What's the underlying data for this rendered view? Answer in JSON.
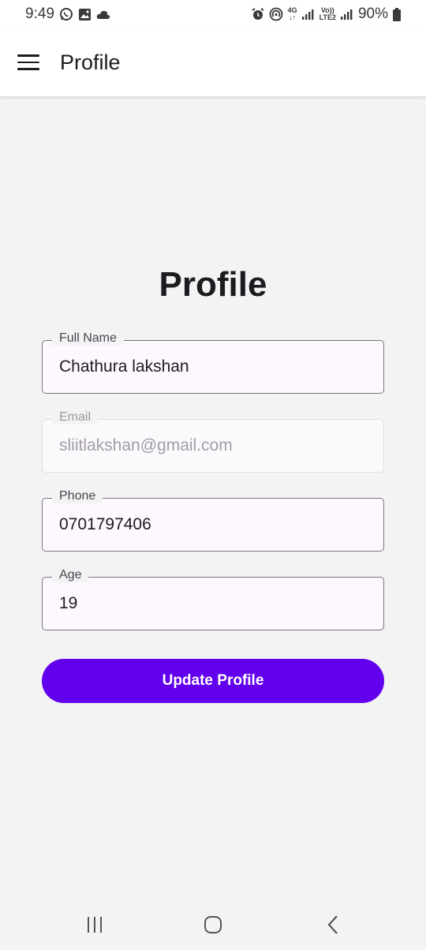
{
  "status_bar": {
    "time": "9:49",
    "network_top": "4G",
    "volte_top": "Vo))",
    "volte_bottom": "LTE2",
    "battery": "90%",
    "left_icons": [
      "whatsapp-icon",
      "gallery-icon",
      "cloud-icon"
    ],
    "right_icons": [
      "alarm-icon",
      "hotspot-icon",
      "signal-icon",
      "battery-icon"
    ]
  },
  "app_bar": {
    "title": "Profile",
    "menu_icon": "hamburger-menu-icon"
  },
  "main": {
    "heading": "Profile",
    "fields": {
      "full_name": {
        "label": "Full Name",
        "value": "Chathura lakshan"
      },
      "email": {
        "label": "Email",
        "value": "sliitlakshan@gmail.com",
        "disabled": true
      },
      "phone": {
        "label": "Phone",
        "value": "0701797406"
      },
      "age": {
        "label": "Age",
        "value": "19"
      }
    },
    "update_button": "Update Profile",
    "accent_color": "#6200ee"
  },
  "nav_bar": {
    "icons": [
      "recent-apps-icon",
      "home-icon",
      "back-icon"
    ]
  }
}
